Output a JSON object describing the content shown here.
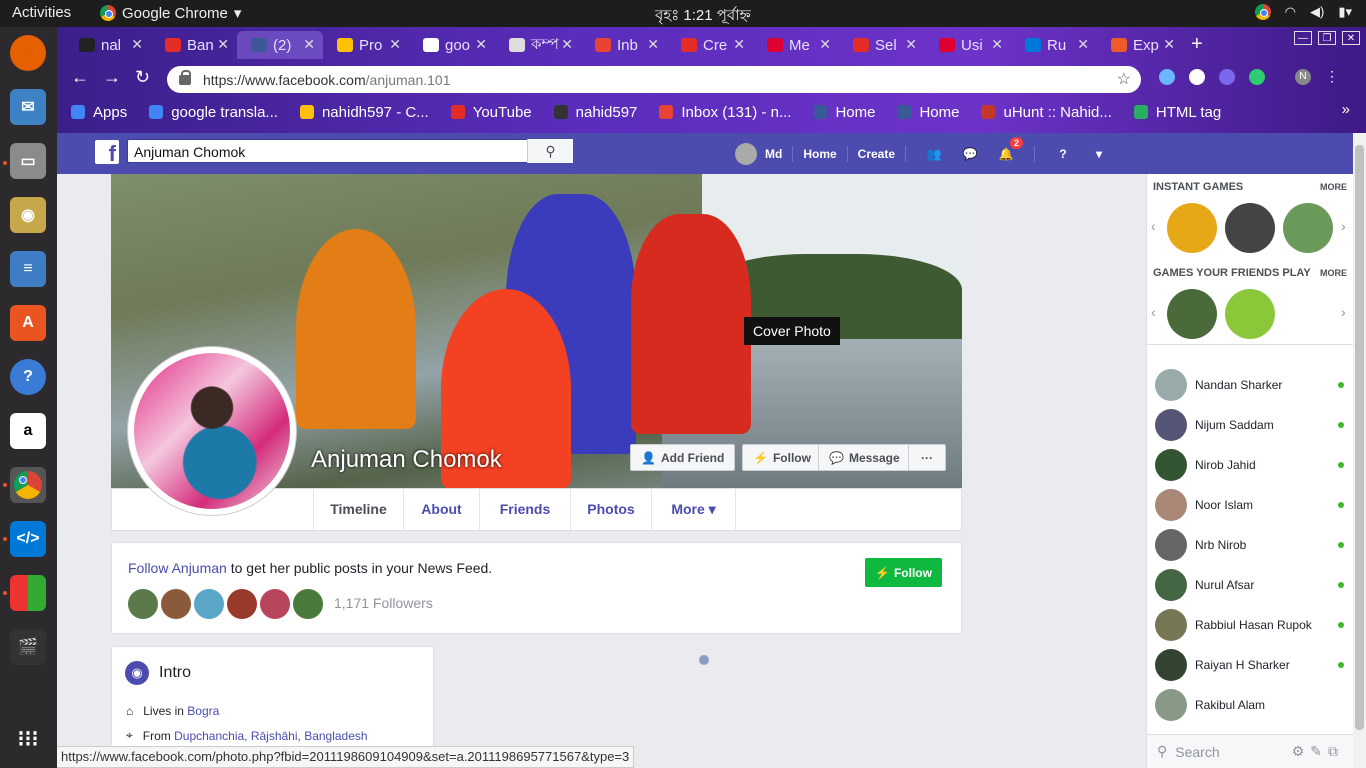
{
  "topbar": {
    "activities": "Activities",
    "app": "Google Chrome",
    "clock": "বৃহঃ  1:21 পূর্বাহ্ন"
  },
  "chrome": {
    "tabs": [
      {
        "label": "nal",
        "color": "#222"
      },
      {
        "label": "Ban",
        "color": "#e52d27"
      },
      {
        "label": "(2)",
        "color": "#3b5998"
      },
      {
        "label": "Pro",
        "color": "#ffc107"
      },
      {
        "label": "goo",
        "color": "#fff"
      },
      {
        "label": "কম্প",
        "color": "#ddd"
      },
      {
        "label": "Inb",
        "color": "#ea4335"
      },
      {
        "label": "Cre",
        "color": "#e52d27"
      },
      {
        "label": "Me",
        "color": "#dd0031"
      },
      {
        "label": "Sel",
        "color": "#e52d27"
      },
      {
        "label": "Usi",
        "color": "#dd0031"
      },
      {
        "label": "Ru",
        "color": "#0078d7"
      },
      {
        "label": "Exp",
        "color": "#f05a28"
      }
    ],
    "url_host": "https://www.facebook.com",
    "url_path": "/anjuman.101",
    "bookmarks": [
      {
        "label": "Apps",
        "color": "#4285f4"
      },
      {
        "label": "google transla...",
        "color": "#4285f4"
      },
      {
        "label": "nahidh597 - C...",
        "color": "#ffc107"
      },
      {
        "label": "YouTube",
        "color": "#e52d27"
      },
      {
        "label": "nahid597",
        "color": "#333"
      },
      {
        "label": "Inbox (131) - n...",
        "color": "#ea4335"
      },
      {
        "label": "Home",
        "color": "#3b5998"
      },
      {
        "label": "Home",
        "color": "#3b5998"
      },
      {
        "label": "uHunt :: Nahid...",
        "color": "#c0392b"
      },
      {
        "label": "HTML tag",
        "color": "#27ae60"
      }
    ]
  },
  "fb": {
    "search": "Anjuman Chomok",
    "user": "Md",
    "home": "Home",
    "create": "Create",
    "notif_count": "2"
  },
  "profile": {
    "name": "Anjuman Chomok",
    "cover_label": "Cover Photo",
    "add_friend": "Add Friend",
    "follow": "Follow",
    "message": "Message",
    "more_dots": "···",
    "tabs": [
      "Timeline",
      "About",
      "Friends",
      "Photos",
      "More ▾"
    ]
  },
  "followbox": {
    "link": "Follow Anjuman",
    "rest": " to get her public posts in your News Feed.",
    "count": "1,171 Followers",
    "button": "Follow"
  },
  "intro": {
    "title": "Intro",
    "lives_label": "Lives in ",
    "lives": "Bogra",
    "from_label": "From ",
    "from": "Dupchanchia, Rājshāhi, Bangladesh"
  },
  "sidebar": {
    "instant_games": "INSTANT GAMES",
    "more1": "MORE",
    "friends_play": "GAMES YOUR FRIENDS PLAY",
    "more2": "MORE",
    "contacts": [
      "Nandan Sharker",
      "Nijum Saddam",
      "Nirob Jahid",
      "Noor Islam",
      "Nrb Nirob",
      "Nurul Afsar",
      "Rabbiul Hasan Rupok",
      "Raiyan H Sharker",
      "Rakibul Alam"
    ],
    "search": "Search"
  },
  "statusbar": "https://www.facebook.com/photo.php?fbid=2011198609104909&set=a.2011198695771567&type=3"
}
